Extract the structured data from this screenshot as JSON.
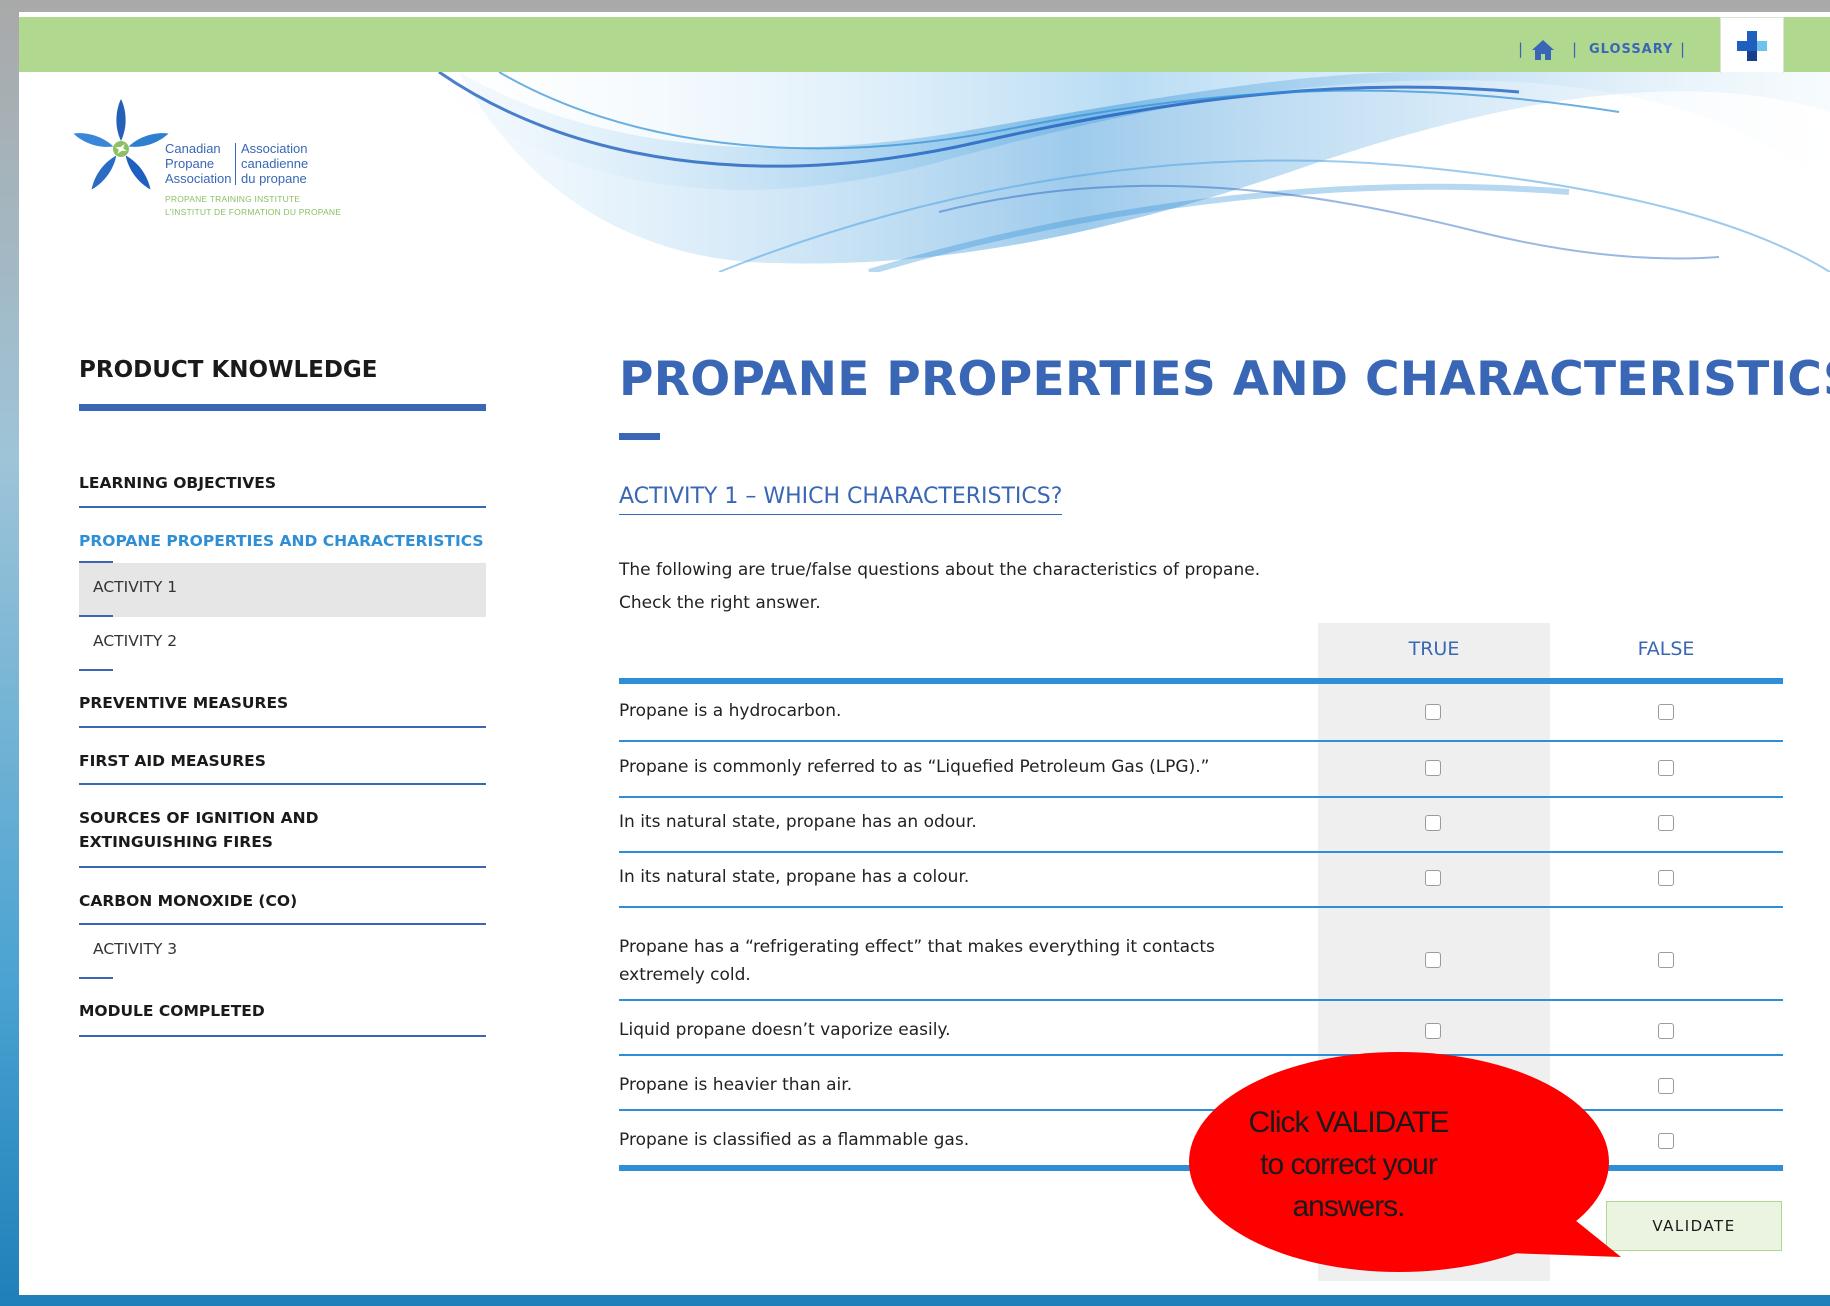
{
  "header": {
    "glossary_label": "GLOSSARY",
    "separator": "|",
    "home_icon": "home-icon",
    "plus_icon": "plus-icon"
  },
  "logo": {
    "en_lines": [
      "Canadian",
      "Propane",
      "Association"
    ],
    "fr_lines": [
      "Association",
      "canadienne",
      "du propane"
    ],
    "sub_en": "PROPANE TRAINING INSTITUTE",
    "sub_fr": "L'INSTITUT DE FORMATION DU PROPANE"
  },
  "sidebar": {
    "title": "PRODUCT KNOWLEDGE",
    "items": [
      {
        "label": "LEARNING OBJECTIVES"
      },
      {
        "label": "PROPANE PROPERTIES AND CHARACTERISTICS"
      },
      {
        "label": "ACTIVITY 1"
      },
      {
        "label": "ACTIVITY 2"
      },
      {
        "label": "PREVENTIVE MEASURES"
      },
      {
        "label": "FIRST AID MEASURES"
      },
      {
        "label": "SOURCES OF IGNITION AND EXTINGUISHING FIRES"
      },
      {
        "label": "CARBON MONOXIDE (CO)"
      },
      {
        "label": "ACTIVITY 3"
      },
      {
        "label": "MODULE COMPLETED"
      }
    ]
  },
  "main": {
    "title": "PROPANE PROPERTIES AND CHARACTERISTICS",
    "activity_heading": "ACTIVITY 1 – WHICH CHARACTERISTICS?",
    "intro_line1": "The following are true/false questions about the characteristics of propane.",
    "intro_line2": "Check the right answer.",
    "col_true": "TRUE",
    "col_false": "FALSE",
    "questions": [
      {
        "text": "Propane is a hydrocarbon."
      },
      {
        "text": "Propane is commonly referred to as “Liquefied Petroleum Gas (LPG).”"
      },
      {
        "text": "In its natural state, propane has an odour."
      },
      {
        "text": "In its natural state, propane has a colour."
      },
      {
        "text": "Propane has a “refrigerating effect” that makes everything it contacts extremely cold."
      },
      {
        "text": "Liquid propane doesn’t vaporize easily."
      },
      {
        "text": "Propane is heavier than air."
      },
      {
        "text": "Propane is classified as a flammable gas."
      }
    ],
    "validate_label": "VALIDATE"
  },
  "callout": {
    "lines": [
      "Click VALIDATE",
      "to correct your",
      "answers."
    ],
    "color": "#ff0000"
  },
  "colors": {
    "brand_blue": "#3a67b5",
    "active_blue": "#2f8fd6",
    "top_bar_green": "#b0d88f",
    "logo_green": "#8cc063"
  }
}
